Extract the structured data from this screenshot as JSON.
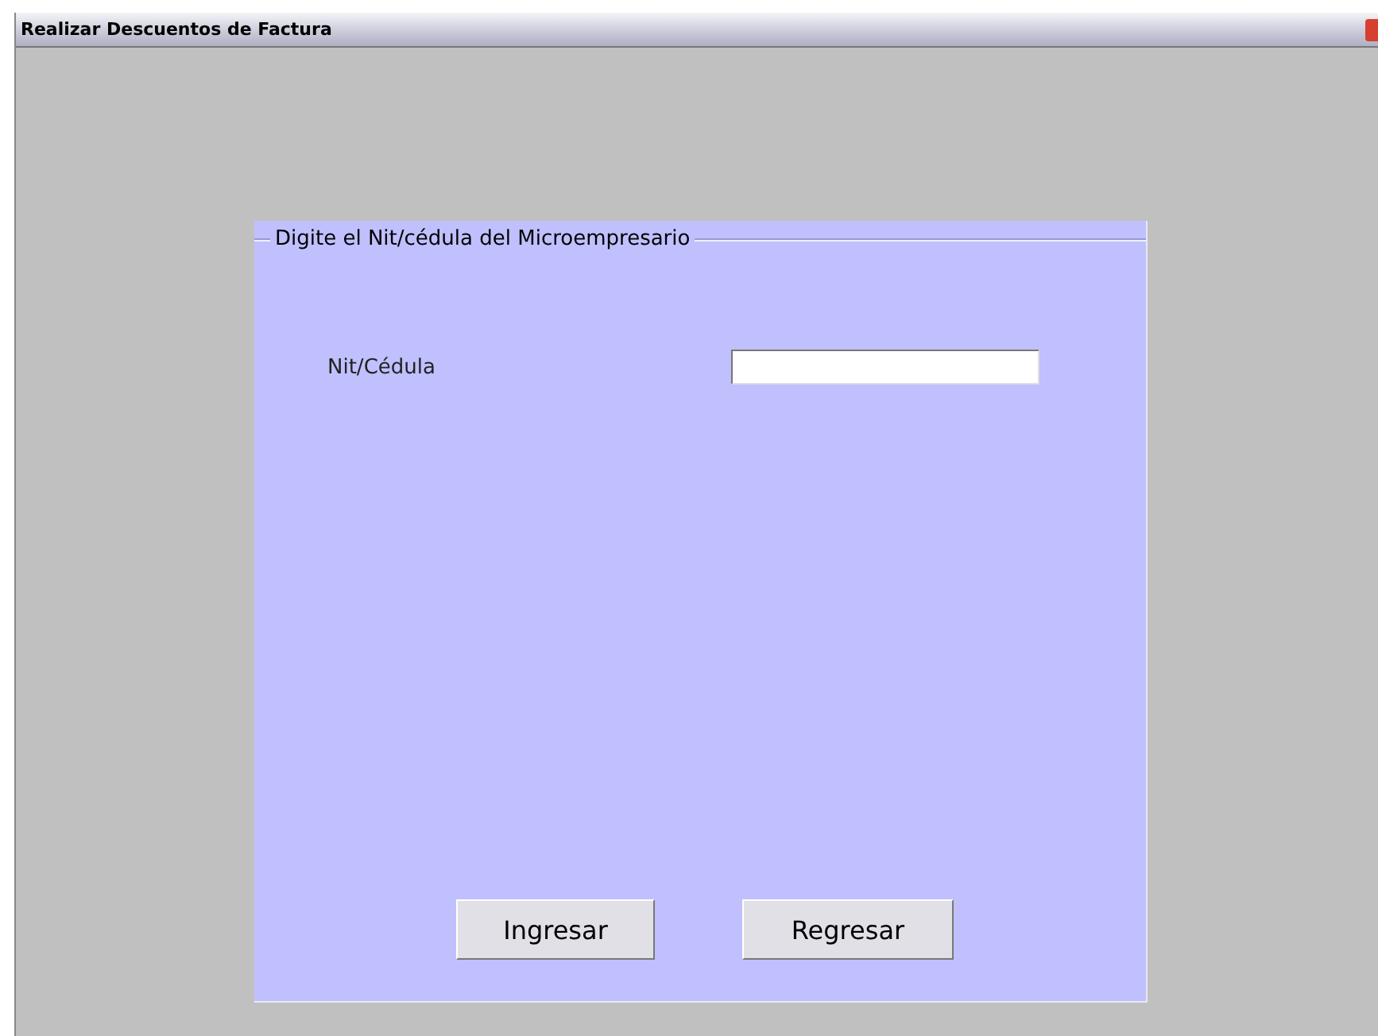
{
  "window": {
    "title": "Realizar Descuentos de Factura"
  },
  "group": {
    "legend": "Digite el Nit/cédula del Microempresario"
  },
  "field": {
    "label": "Nit/Cédula"
  },
  "buttons": [
    {
      "label": "Ingresar"
    },
    {
      "label": "Regresar"
    }
  ]
}
